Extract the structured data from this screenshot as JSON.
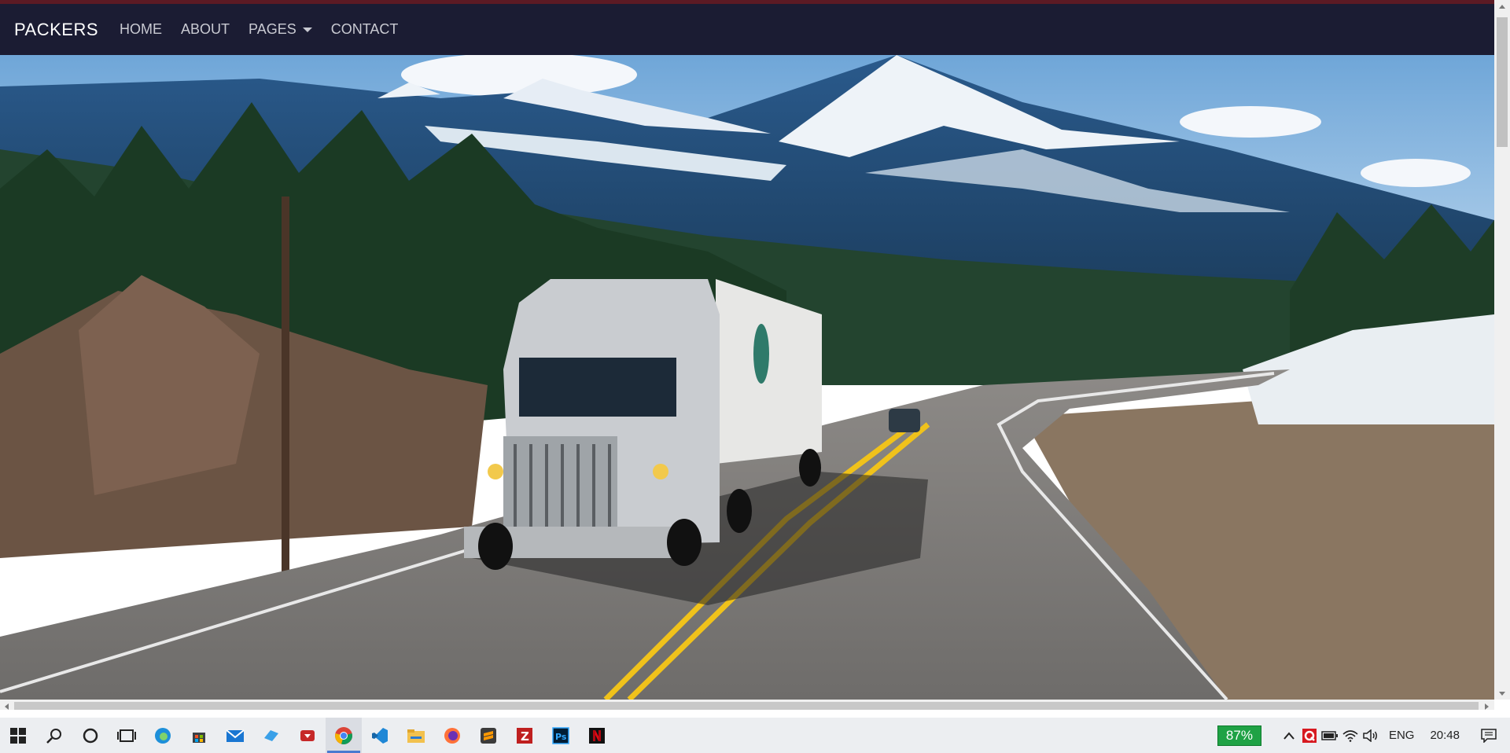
{
  "navbar": {
    "brand": "PACKERS",
    "items": [
      {
        "label": "HOME"
      },
      {
        "label": "ABOUT"
      },
      {
        "label": "PAGES"
      },
      {
        "label": "CONTACT"
      }
    ]
  },
  "hero": {
    "image": "mountain-highway-truck-photo"
  },
  "taskbar": {
    "apps": [
      "start-icon",
      "search-icon",
      "cortana-icon",
      "task-view-icon",
      "edge-icon",
      "store-icon",
      "mail-icon",
      "files-icon",
      "download-icon",
      "chrome-icon",
      "vscode-icon",
      "file-explorer-icon",
      "firefox-icon",
      "sublime-icon",
      "filezilla-icon",
      "photoshop-icon",
      "netflix-icon"
    ],
    "active_app": "chrome-icon",
    "battery_percent": "87%",
    "language": "ENG",
    "time": "20:48"
  },
  "colors": {
    "navbar_bg": "#1b1c33",
    "accent_line": "#5c1a24",
    "taskbar_bg": "#eceef1",
    "battery_green": "#1fa245"
  }
}
